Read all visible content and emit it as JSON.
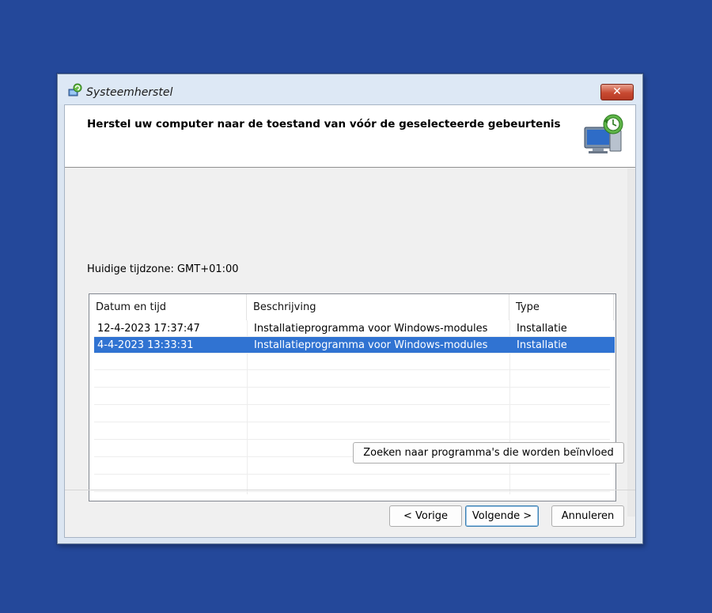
{
  "window": {
    "title": "Systeemherstel",
    "close_label": "✕"
  },
  "header": {
    "title": "Herstel uw computer naar de toestand van vóór de geselecteerde gebeurtenis"
  },
  "timezone_label": "Huidige tijdzone: GMT+01:00",
  "table": {
    "columns": [
      "Datum en tijd",
      "Beschrijving",
      "Type"
    ],
    "sort_indicator": "ˇ",
    "rows": [
      {
        "datetime": "12-4-2023 17:37:47",
        "description": "Installatieprogramma voor Windows-modules",
        "type": "Installatie",
        "selected": false
      },
      {
        "datetime": "4-4-2023 13:33:31",
        "description": "Installatieprogramma voor Windows-modules",
        "type": "Installatie",
        "selected": true
      }
    ]
  },
  "buttons": {
    "scan": "Zoeken naar programma's die worden beïnvloed",
    "back": "< Vorige",
    "next": "Volgende >",
    "cancel": "Annuleren"
  },
  "colors": {
    "desktop": "#24489a",
    "selection": "#3073d2"
  },
  "icons": {
    "title": "system-restore-icon",
    "header": "computer-restore-icon"
  }
}
